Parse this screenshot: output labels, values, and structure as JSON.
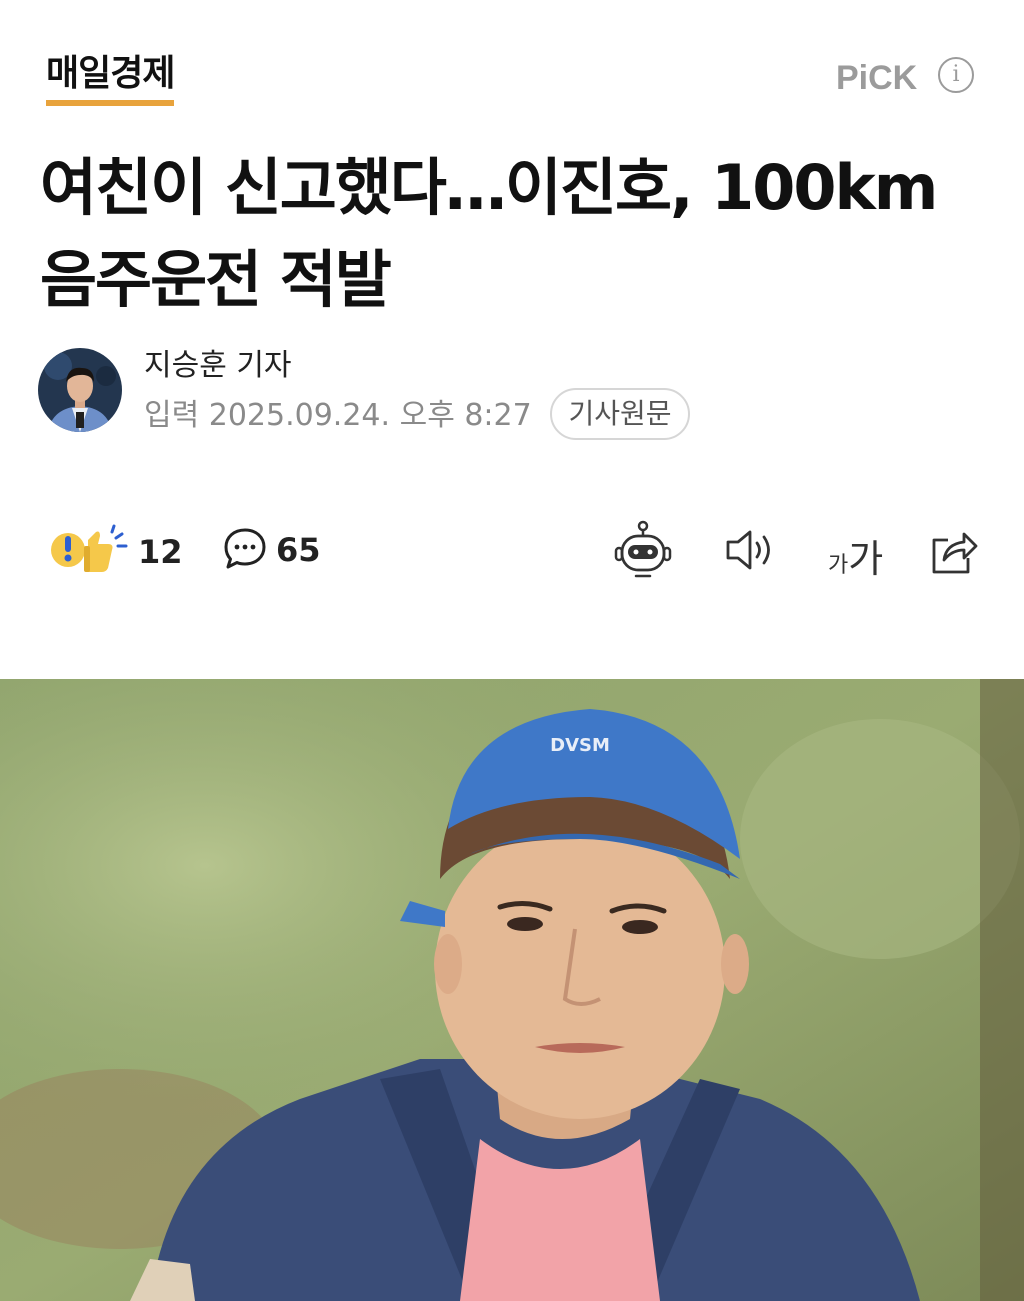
{
  "header": {
    "press_name": "매일경제",
    "pick_label": "PiCK",
    "info_icon": "info-icon",
    "press_underline_color": "#e8a33c"
  },
  "article": {
    "title": "여친이 신고했다…이진호, 100km 음주운전 적발",
    "reporter": "지승훈 기자",
    "date_label": "입력",
    "date_value": "2025.09.24. 오후 8:27",
    "original_button": "기사원문"
  },
  "actions": {
    "reaction_icon": "reaction-emoji-icon",
    "reaction_count": "12",
    "comment_icon": "comment-bubble-icon",
    "comment_count": "65",
    "tools": [
      {
        "name": "summary-bot-icon"
      },
      {
        "name": "text-to-speech-icon"
      },
      {
        "name": "font-size-icon",
        "small": "가",
        "large": "가"
      },
      {
        "name": "share-icon"
      }
    ]
  },
  "photo": {
    "subject": "man-in-blue-cap-photo"
  }
}
